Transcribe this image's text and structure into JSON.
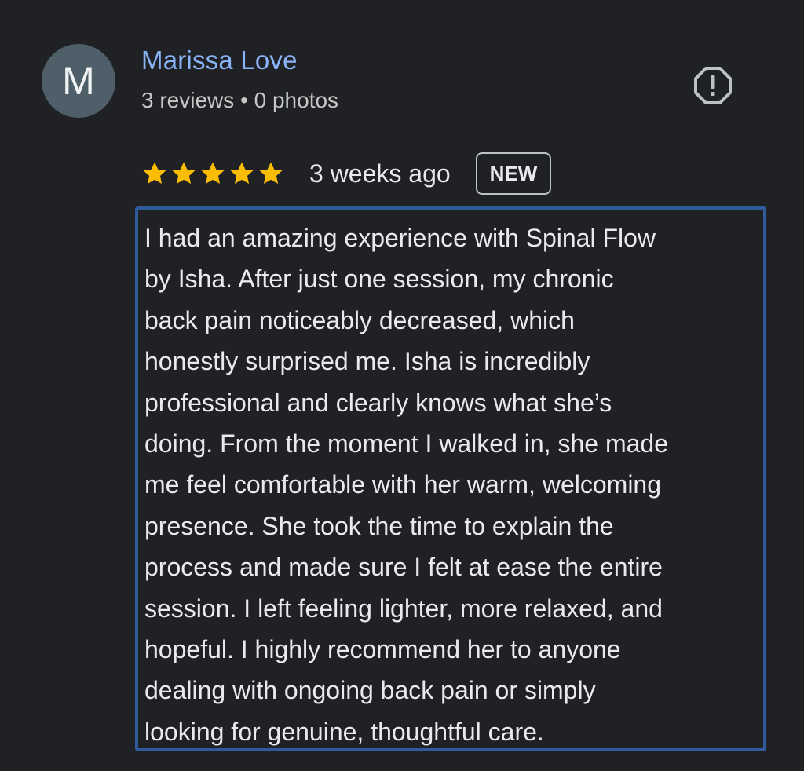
{
  "reviewer": {
    "avatar_initial": "M",
    "avatar_color": "#4f5f69",
    "name": "Marissa Love",
    "name_color": "#8ab4f8",
    "meta": "3 reviews • 0 photos"
  },
  "report_button": {
    "icon": "report-flag-icon"
  },
  "rating": {
    "stars": 5,
    "max_stars": 5,
    "star_color": "#fbbc04",
    "time": "3 weeks ago",
    "badge": "NEW"
  },
  "review": {
    "lines": [
      "I had an amazing experience with Spinal Flow",
      "by Isha. After just one session, my chronic",
      "back pain noticeably decreased, which",
      "honestly surprised me. Isha is incredibly",
      "professional and clearly knows what she’s",
      "doing. From the moment I walked in, she made",
      "me feel comfortable with her warm, welcoming",
      "presence. She took the time to explain the",
      "process and made sure I felt at ease the entire",
      "session. I left feeling lighter, more relaxed, and",
      "hopeful. I highly recommend her to anyone",
      "dealing with ongoing back pain or simply",
      "looking for genuine, thoughtful care."
    ],
    "highlight_color": "#2f5b9c"
  }
}
